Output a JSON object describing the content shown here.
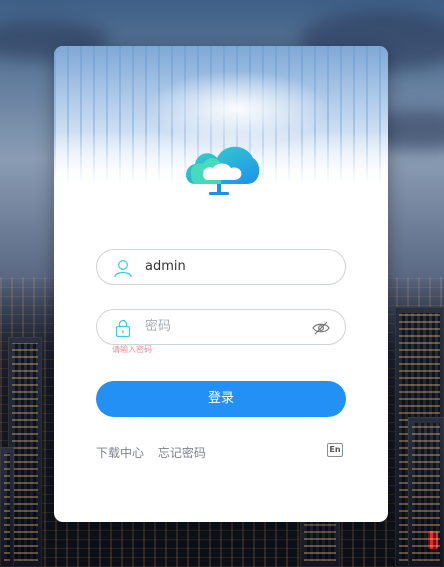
{
  "login": {
    "username_value": "admin",
    "password_placeholder": "密码",
    "password_error": "请输入密码",
    "login_label": "登录",
    "download_center": "下载中心",
    "forgot_password": "忘记密码",
    "language_toggle": "En"
  },
  "colors": {
    "accent": "#2290f5",
    "icon": "#3dcfe0",
    "error": "#f2899a"
  },
  "icons": [
    "cloud-logo-icon",
    "user-icon",
    "lock-icon",
    "eye-hidden-icon",
    "language-icon"
  ]
}
